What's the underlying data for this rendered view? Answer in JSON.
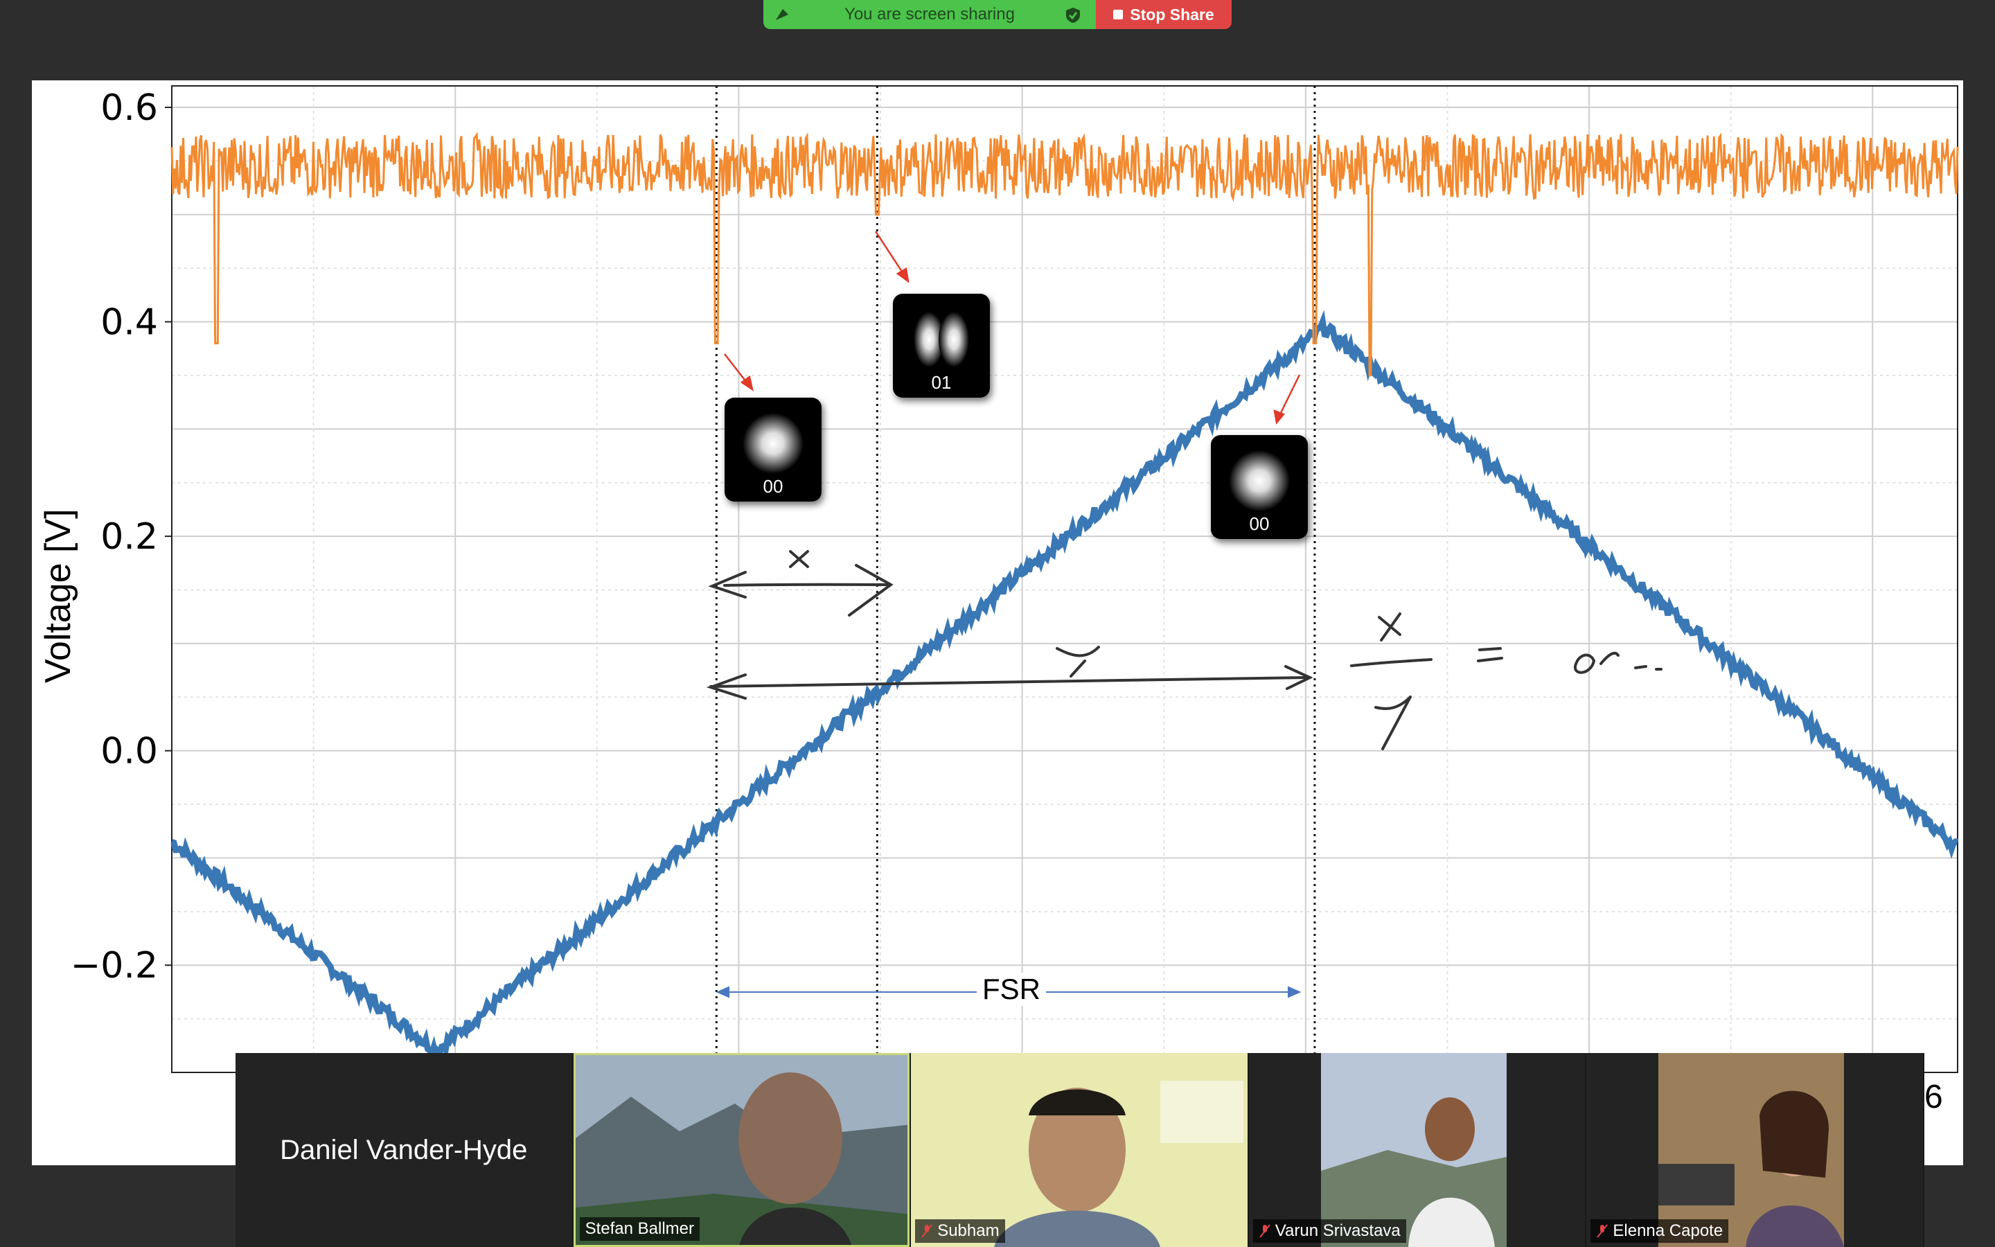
{
  "share_bar": {
    "status_text": "You are screen sharing",
    "stop_label": "Stop Share",
    "status_color": "#4cc34a",
    "stop_color": "#e04545"
  },
  "shared_screen": {
    "chart_data": {
      "type": "line",
      "ylabel": "Voltage [V]",
      "ylim": [
        -0.3,
        0.62
      ],
      "yticks": [
        "0.6",
        "0.4",
        "0.2",
        "0.0",
        "−0.2"
      ],
      "ytick_values": [
        0.6,
        0.4,
        0.2,
        0.0,
        -0.2
      ],
      "grid": true,
      "x_tick_partial": "6",
      "series": [
        {
          "color": "#f28a30",
          "description_points": [
            [
              0.0,
              0.545
            ],
            [
              1.0,
              0.545
            ]
          ],
          "dips": [
            [
              0.025,
              0.38
            ],
            [
              0.305,
              0.38
            ],
            [
              0.395,
              0.5
            ],
            [
              0.64,
              0.38
            ],
            [
              0.671,
              0.35
            ]
          ]
        },
        {
          "color": "#3a78b5",
          "points": [
            [
              0.0,
              -0.085
            ],
            [
              0.148,
              -0.28
            ],
            [
              0.645,
              0.395
            ],
            [
              1.0,
              -0.09
            ]
          ]
        }
      ],
      "vertical_markers_x": [
        0.305,
        0.395,
        0.64
      ],
      "mode_labels": [
        "00",
        "01",
        "00"
      ],
      "fsr_label": "FSR"
    }
  },
  "participants": [
    {
      "name": "Daniel Vander-Hyde",
      "video": false,
      "muted": false
    },
    {
      "name": "Stefan Ballmer",
      "video": true,
      "muted": false,
      "active": true
    },
    {
      "name": "Subham",
      "video": true,
      "muted": true
    },
    {
      "name": "Varun Srivastava",
      "video": true,
      "muted": true
    },
    {
      "name": "Elenna Capote",
      "video": true,
      "muted": true
    }
  ]
}
